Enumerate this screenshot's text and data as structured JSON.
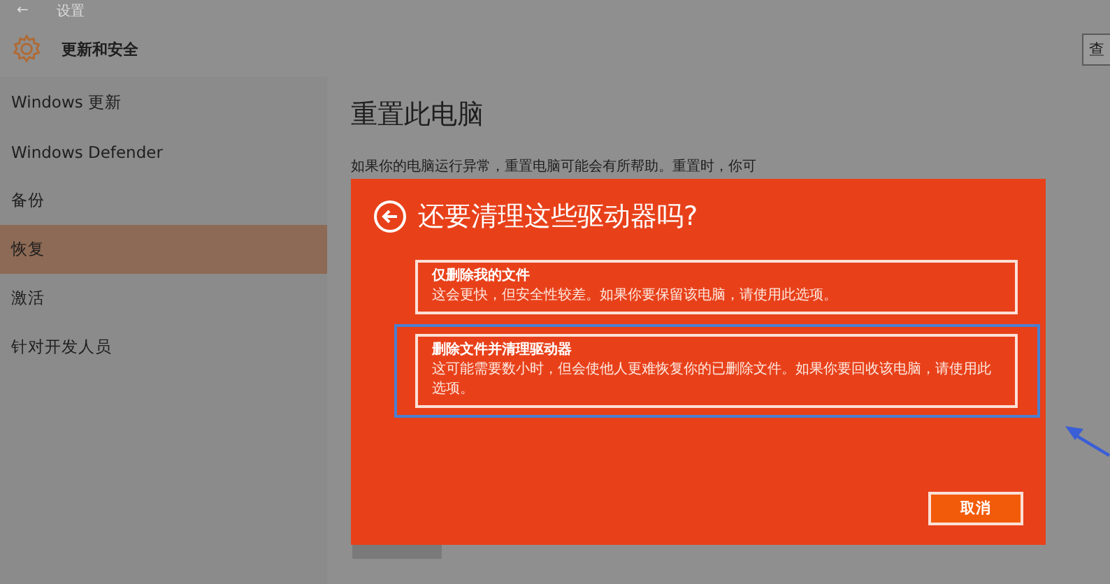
{
  "window": {
    "back": "←",
    "title": "设置"
  },
  "header": {
    "title": "更新和安全",
    "search_button": "查"
  },
  "sidebar": {
    "items": [
      {
        "label": "Windows 更新",
        "selected": false
      },
      {
        "label": "Windows Defender",
        "selected": false
      },
      {
        "label": "备份",
        "selected": false
      },
      {
        "label": "恢复",
        "selected": true
      },
      {
        "label": "激活",
        "selected": false
      },
      {
        "label": "针对开发人员",
        "selected": false
      }
    ]
  },
  "main": {
    "title": "重置此电脑",
    "paragraph": "如果你的电脑运行异常，重置电脑可能会有所帮助。重置时，你可"
  },
  "dialog": {
    "title": "还要清理这些驱动器吗?",
    "options": [
      {
        "title": "仅删除我的文件",
        "description": "这会更快，但安全性较差。如果你要保留该电脑，请使用此选项。",
        "selected": false
      },
      {
        "title": "删除文件并清理驱动器",
        "description": "这可能需要数小时，但会使他人更难恢复你的已删除文件。如果你要回收该电脑，请使用此选项。",
        "selected": true
      }
    ],
    "cancel": "取消"
  }
}
